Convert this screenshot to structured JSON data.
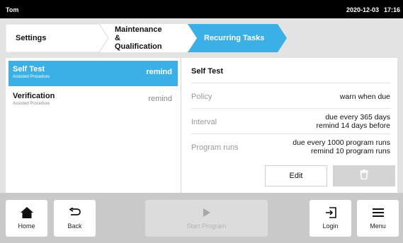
{
  "status_bar": {
    "user": "Tom",
    "date": "2020-12-03",
    "time": "17:16"
  },
  "breadcrumb": {
    "settings": "Settings",
    "maintenance": "Maintenance & Qualification",
    "recurring": "Recurring Tasks"
  },
  "tasks": [
    {
      "title": "Self Test",
      "subtitle": "Assisted Procedure",
      "status": "remind"
    },
    {
      "title": "Verification",
      "subtitle": "Assisted Procedure",
      "status": "remind"
    }
  ],
  "detail": {
    "title": "Self Test",
    "policy_label": "Policy",
    "policy_value": "warn when due",
    "interval_label": "Interval",
    "interval_line1": "due every 365 days",
    "interval_line2": "remind 14 days before",
    "runs_label": "Program runs",
    "runs_line1": "due every 1000 program runs",
    "runs_line2": "remind 10 program runs",
    "edit_label": "Edit"
  },
  "nav": {
    "home": "Home",
    "back": "Back",
    "start_program": "Start Program",
    "login": "Login",
    "menu": "Menu"
  },
  "colors": {
    "accent": "#3ab0e6",
    "status_bar": "#000000",
    "background": "#e3e3e3"
  },
  "icons": [
    "home-icon",
    "back-icon",
    "play-icon",
    "login-icon",
    "menu-icon",
    "trash-icon"
  ]
}
